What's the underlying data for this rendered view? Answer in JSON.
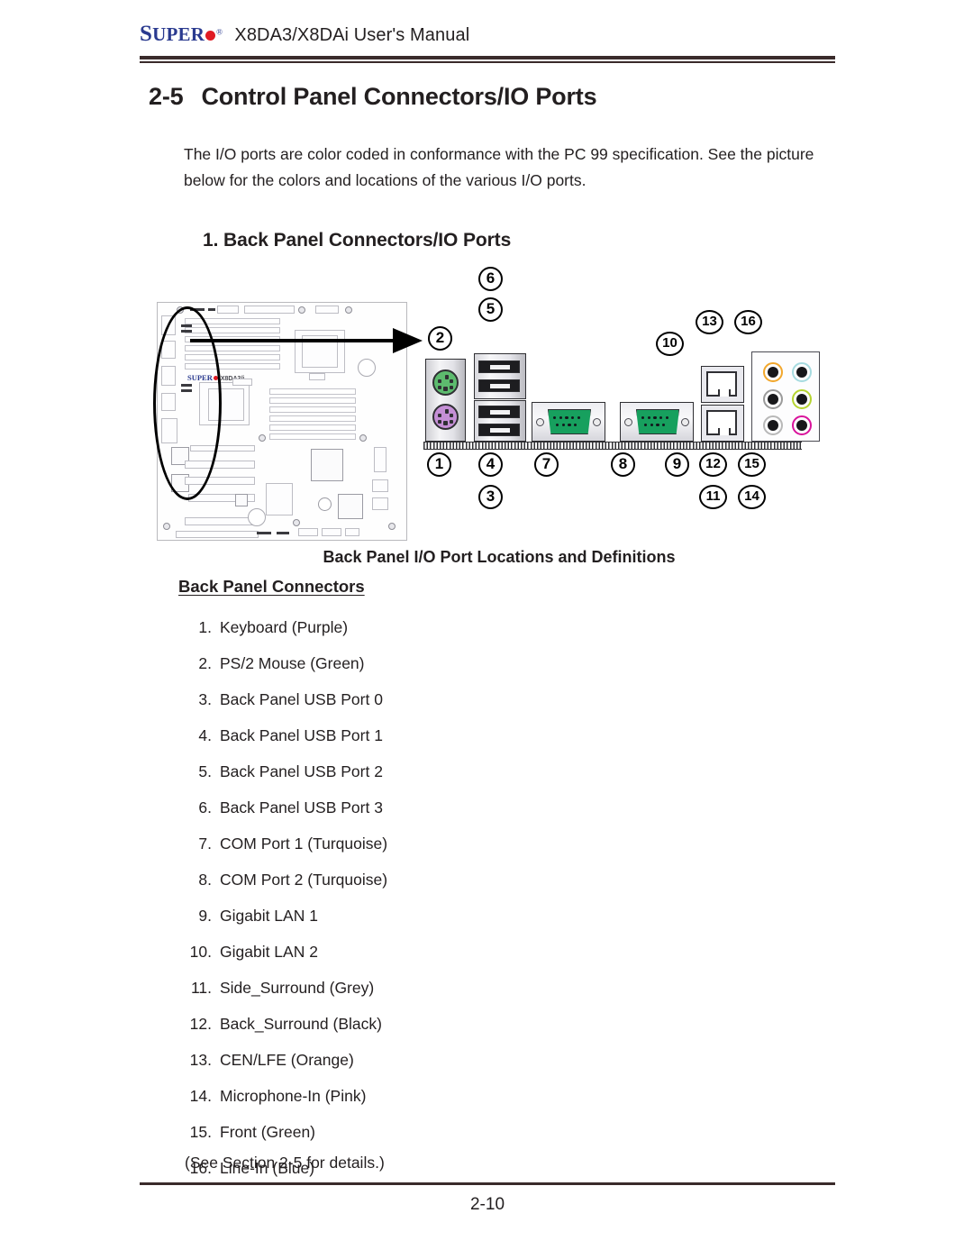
{
  "header": {
    "logo_super": "SUPER",
    "logo_dot": "red-dot",
    "logo_reg": "®",
    "title": "X8DA3/X8DAi User's Manual"
  },
  "section": {
    "number": "2-5",
    "title": "Control Panel Connectors/IO Ports",
    "intro": "The I/O ports are color coded in conformance with the PC 99 specification. See the picture below for the colors and locations of the various I/O ports.",
    "subhead": "1. Back Panel Connectors/IO Ports"
  },
  "figure": {
    "caption": "Back Panel I/O Port Locations and Definitions",
    "board_logo_super": "SUPER",
    "board_model": "X8DA3/i",
    "callouts": [
      {
        "n": "6"
      },
      {
        "n": "5"
      },
      {
        "n": "2"
      },
      {
        "n": "1"
      },
      {
        "n": "3"
      },
      {
        "n": "4"
      },
      {
        "n": "7"
      },
      {
        "n": "8"
      },
      {
        "n": "9"
      },
      {
        "n": "10"
      },
      {
        "n": "11"
      },
      {
        "n": "12"
      },
      {
        "n": "13"
      },
      {
        "n": "14"
      },
      {
        "n": "15"
      },
      {
        "n": "16"
      }
    ],
    "colors": {
      "ps2_mouse_green": "#5dbb6e",
      "ps2_keyboard_purple": "#c58fd6",
      "com_turquoise": "#17a05e",
      "lan_led_yellow": "#f2e11c",
      "lan_led_green": "#2fc04a",
      "audio_cen_lfe_orange": "#f2a72c",
      "audio_line_in_blue": "#a6dbe0",
      "audio_side_surround_grey": "#9a9a9a",
      "audio_front_green": "#b5d430",
      "audio_back_surround_black": "#b8b8b8",
      "audio_mic_in_pink": "#d9129b"
    },
    "audio_jacks": [
      {
        "name": "CEN/LFE",
        "ring": "#f2a72c"
      },
      {
        "name": "Line-In",
        "ring": "#a6dbe0"
      },
      {
        "name": "Side_Surround",
        "ring": "#9a9a9a"
      },
      {
        "name": "Front",
        "ring": "#b5d430"
      },
      {
        "name": "Back_Surround",
        "ring": "#b8b8b8"
      },
      {
        "name": "Microphone-In",
        "ring": "#d9129b"
      }
    ]
  },
  "connectors": {
    "heading": "Back Panel Connectors",
    "items": [
      {
        "idx": "1.",
        "label": "Keyboard (Purple)"
      },
      {
        "idx": "2.",
        "label": "PS/2 Mouse (Green)"
      },
      {
        "idx": "3.",
        "label": "Back Panel USB Port 0"
      },
      {
        "idx": "4.",
        "label": "Back Panel USB Port 1"
      },
      {
        "idx": "5.",
        "label": "Back Panel USB Port 2"
      },
      {
        "idx": "6.",
        "label": "Back Panel USB Port 3"
      },
      {
        "idx": "7.",
        "label": "COM Port 1 (Turquoise)"
      },
      {
        "idx": "8.",
        "label": "COM Port 2 (Turquoise)"
      },
      {
        "idx": "9.",
        "label": "Gigabit LAN 1"
      },
      {
        "idx": "10.",
        "label": "Gigabit LAN 2"
      },
      {
        "idx": "11.",
        "label": "Side_Surround (Grey)"
      },
      {
        "idx": "12.",
        "label": "Back_Surround (Black)"
      },
      {
        "idx": "13.",
        "label": "CEN/LFE (Orange)"
      },
      {
        "idx": "14.",
        "label": "Microphone-In (Pink)"
      },
      {
        "idx": "15.",
        "label": "Front (Green)"
      },
      {
        "idx": "16.",
        "label": "Line-In (Blue)"
      }
    ],
    "note": "(See Section 2-5 for details.)"
  },
  "footer": {
    "page": "2-10"
  }
}
